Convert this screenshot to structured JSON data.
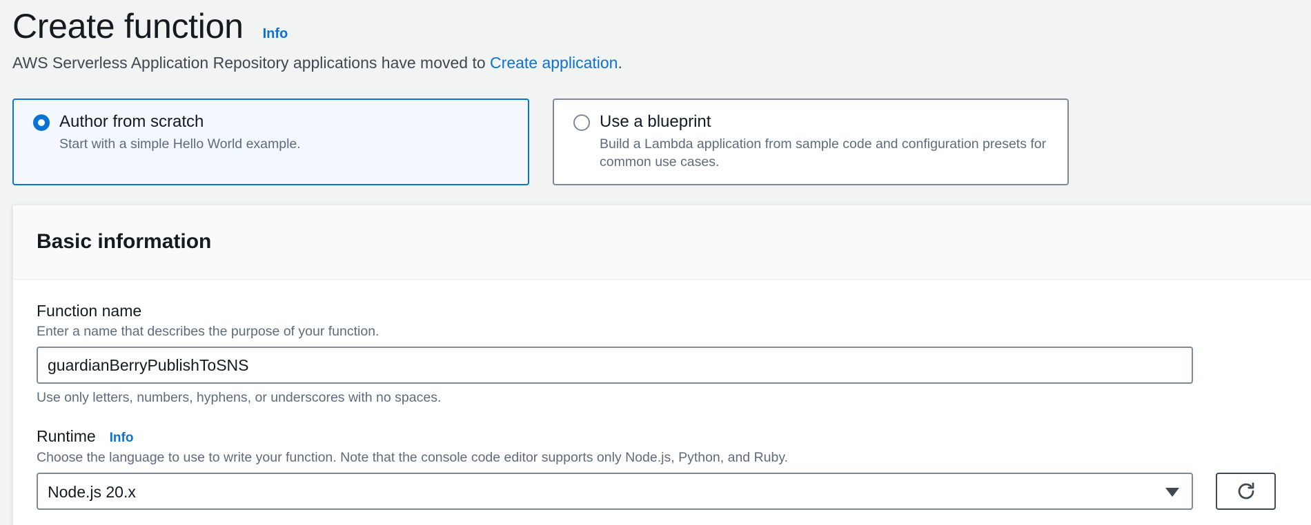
{
  "header": {
    "title": "Create function",
    "info_label": "Info"
  },
  "notice": {
    "text_before": "AWS Serverless Application Repository applications have moved to ",
    "link_text": "Create application",
    "text_after": "."
  },
  "options": [
    {
      "title": "Author from scratch",
      "description": "Start with a simple Hello World example.",
      "selected": true
    },
    {
      "title": "Use a blueprint",
      "description": "Build a Lambda application from sample code and configuration presets for common use cases.",
      "selected": false
    }
  ],
  "basic_info": {
    "title": "Basic information",
    "function_name": {
      "label": "Function name",
      "description": "Enter a name that describes the purpose of your function.",
      "value": "guardianBerryPublishToSNS",
      "constraint": "Use only letters, numbers, hyphens, or underscores with no spaces."
    },
    "runtime": {
      "label": "Runtime",
      "info_label": "Info",
      "description": "Choose the language to use to write your function. Note that the console code editor supports only Node.js, Python, and Ruby.",
      "selected": "Node.js 20.x"
    }
  },
  "colors": {
    "accent": "#0972d3",
    "selected_tile_bg": "#f2f8fd",
    "page_bg": "#f2f3f3",
    "border": "#7d8998"
  },
  "icons": {
    "refresh": "refresh-icon",
    "dropdown": "caret-down-icon"
  }
}
